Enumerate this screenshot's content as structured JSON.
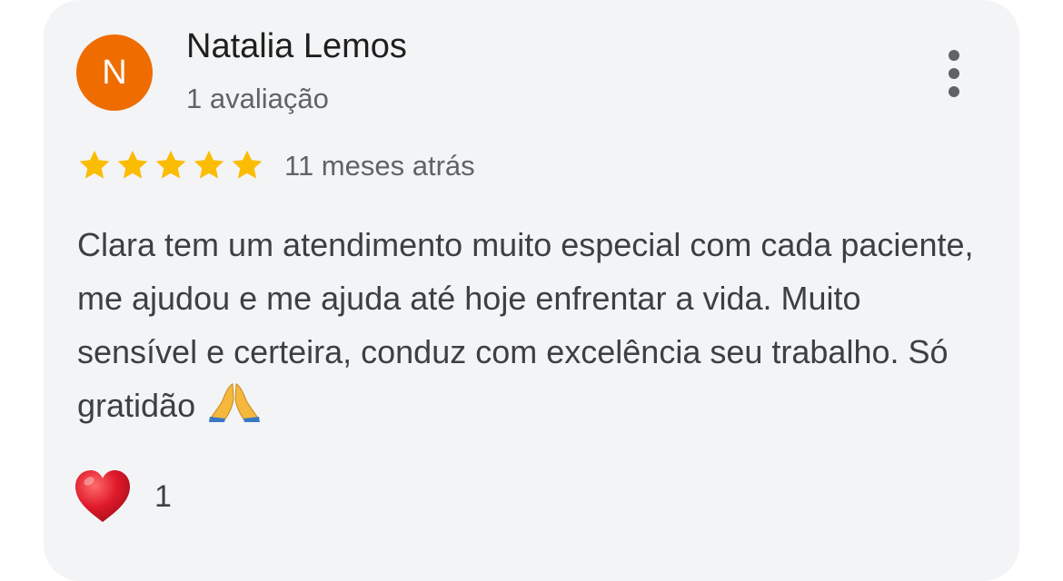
{
  "author": {
    "initial": "N",
    "name": "Natalia Lemos",
    "meta": "1 avaliação",
    "avatar_color": "#ef6c00"
  },
  "menu": {
    "icon": "more-vertical-icon"
  },
  "review": {
    "rating": 5,
    "rating_max": 5,
    "star_color": "#fbbc04",
    "time": "11 meses atrás",
    "text": "Clara tem um atendimento muito especial com cada paciente, me ajudou e me ajuda até hoje enfrentar a vida. Muito sensível e certeira, conduz com excelência seu trabalho. Só gratidão",
    "text_emoji": "folded-hands-icon"
  },
  "reaction": {
    "icon": "heart-icon",
    "count": "1"
  }
}
